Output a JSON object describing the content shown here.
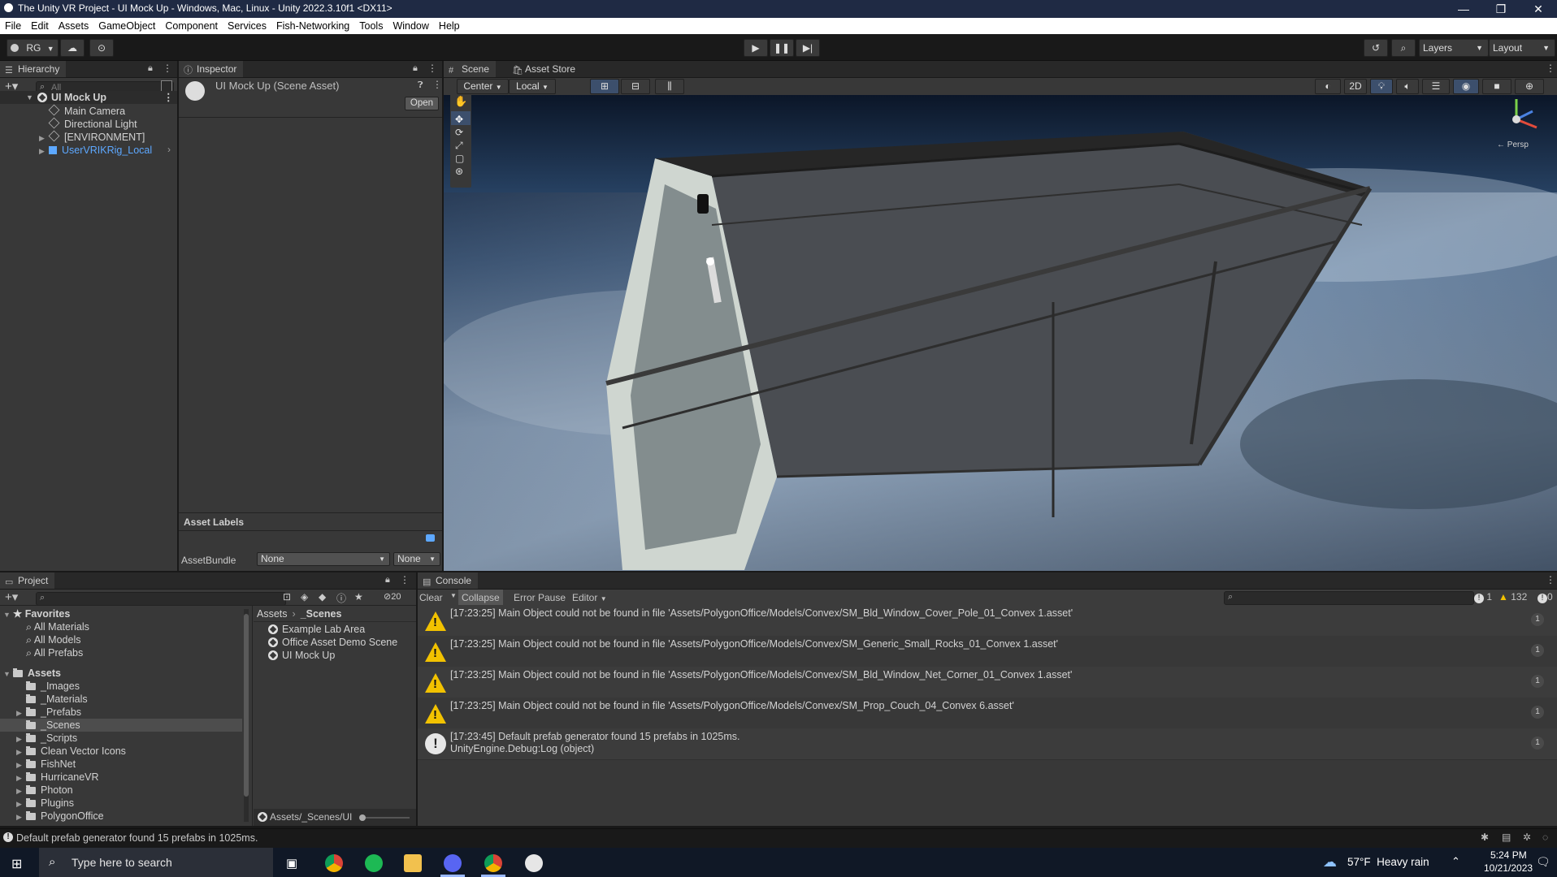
{
  "window": {
    "title": "The Unity VR Project - UI Mock Up - Windows, Mac, Linux - Unity 2022.3.10f1 <DX11>",
    "min": "—",
    "max": "❐",
    "close": "✕"
  },
  "menu": [
    "File",
    "Edit",
    "Assets",
    "GameObject",
    "Component",
    "Services",
    "Fish-Networking",
    "Tools",
    "Window",
    "Help"
  ],
  "toolbar": {
    "account": "RG",
    "layers": "Layers",
    "layout": "Layout"
  },
  "hierarchy": {
    "tab": "Hierarchy",
    "search_placeholder": "All",
    "scene": "UI Mock Up",
    "items": [
      "Main Camera",
      "Directional Light",
      "[ENVIRONMENT]",
      "UserVRIKRig_Local"
    ]
  },
  "inspector": {
    "tab": "Inspector",
    "title": "UI Mock Up (Scene Asset)",
    "open_button": "Open",
    "asset_labels": "Asset Labels",
    "assetbundle_label": "AssetBundle",
    "assetbundle_value": "None",
    "variant_value": "None"
  },
  "scene": {
    "tabs": [
      "Scene",
      "Asset Store"
    ],
    "pivot": "Center",
    "space": "Local",
    "mode_2d": "2D",
    "gizmo_label": "← Persp"
  },
  "project": {
    "tab": "Project",
    "favorites_header": "Favorites",
    "favorites": [
      "All Materials",
      "All Models",
      "All Prefabs"
    ],
    "assets_header": "Assets",
    "folders": [
      "_Images",
      "_Materials",
      "_Prefabs",
      "_Scenes",
      "_Scripts",
      "Clean Vector Icons",
      "FishNet",
      "HurricaneVR",
      "Photon",
      "Plugins",
      "PolygonOffice"
    ],
    "breadcrumb": [
      "Assets",
      "_Scenes"
    ],
    "files": [
      "Example Lab Area",
      "Office Asset Demo Scene",
      "UI Mock Up"
    ],
    "path": "Assets/_Scenes/UI",
    "hidden_count": "20"
  },
  "console": {
    "tab": "Console",
    "clear": "Clear",
    "collapse": "Collapse",
    "error_pause": "Error Pause",
    "editor": "Editor",
    "info_count": "1",
    "warn_count": "132",
    "err_count": "0",
    "logs": [
      {
        "text": "[17:23:25] Main Object could not be found in file 'Assets/PolygonOffice/Models/Convex/SM_Bld_Window_Cover_Pole_01_Convex 1.asset'",
        "count": "1"
      },
      {
        "text": "[17:23:25] Main Object could not be found in file 'Assets/PolygonOffice/Models/Convex/SM_Generic_Small_Rocks_01_Convex 1.asset'",
        "count": "1"
      },
      {
        "text": "[17:23:25] Main Object could not be found in file 'Assets/PolygonOffice/Models/Convex/SM_Bld_Window_Net_Corner_01_Convex 1.asset'",
        "count": "1"
      },
      {
        "text": "[17:23:25] Main Object could not be found in file 'Assets/PolygonOffice/Models/Convex/SM_Prop_Couch_04_Convex 6.asset'",
        "count": "1"
      },
      {
        "text": "[17:23:45] Default prefab generator found 15 prefabs in 1025ms.",
        "sub": "UnityEngine.Debug:Log (object)",
        "count": "1"
      }
    ]
  },
  "statusbar": {
    "text": "Default prefab generator found 15 prefabs in 1025ms."
  },
  "taskbar": {
    "search_placeholder": "Type here to search",
    "weather": "57°F  Heavy rain",
    "time": "5:24 PM",
    "date": "10/21/2023"
  },
  "colors": {
    "accent": "#4c7cc2",
    "warning": "#f2c200",
    "link": "#5da8ff"
  }
}
